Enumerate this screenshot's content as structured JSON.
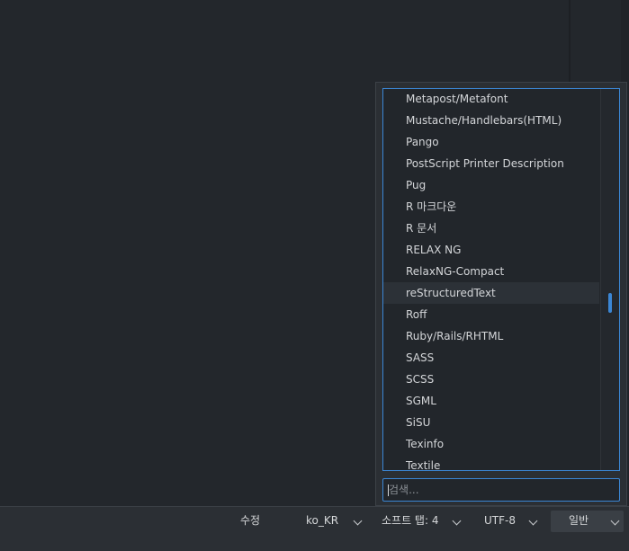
{
  "language_menu": {
    "items": [
      "Metapost/Metafont",
      "Mustache/Handlebars(HTML)",
      "Pango",
      "PostScript Printer Description",
      "Pug",
      "R 마크다운",
      "R 문서",
      "RELAX NG",
      "RelaxNG-Compact",
      "reStructuredText",
      "Roff",
      "Ruby/Rails/RHTML",
      "SASS",
      "SCSS",
      "SGML",
      "SiSU",
      "Texinfo",
      "Textile"
    ],
    "hovered_item": "reStructuredText",
    "scroll_position": 0.62,
    "search_placeholder": "검색..."
  },
  "statusbar": {
    "mode_label": "수정",
    "locale_label": "ko_KR",
    "indent_label": "소프트 탭: 4",
    "encoding_label": "UTF-8",
    "syntax_label": "일반"
  },
  "colors": {
    "accent": "#3b86d4",
    "background": "#23272c",
    "panel": "#2b2f34"
  }
}
